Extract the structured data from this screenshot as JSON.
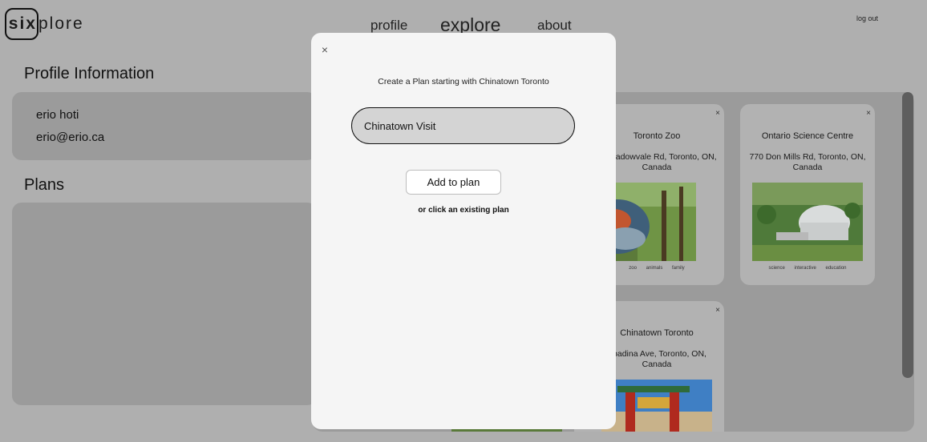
{
  "header": {
    "logo_bold": "six",
    "logo_rest": "plore",
    "nav": {
      "profile": "profile",
      "explore": "explore",
      "about": "about"
    },
    "logout": "log out"
  },
  "profile": {
    "title": "Profile Information",
    "name": "erio hoti",
    "email": "erio@erio.ca"
  },
  "plans": {
    "title": "Plans"
  },
  "explore_cards": [
    {
      "name": "Toronto Zoo",
      "address": "0 Meadowvale Rd, Toronto, ON, Canada",
      "tags": [
        "zoo",
        "animals",
        "family"
      ],
      "close": "×"
    },
    {
      "name": "Ontario Science Centre",
      "address": "770 Don Mills Rd, Toronto, ON, Canada",
      "tags": [
        "science",
        "interactive",
        "education"
      ],
      "close": "×"
    },
    {
      "name": "Chinatown Toronto",
      "address": "Spadina Ave, Toronto, ON, Canada",
      "close": "×"
    }
  ],
  "modal": {
    "close": "×",
    "title": "Create a Plan starting with Chinatown Toronto",
    "input_value": "Chinatown Visit",
    "add_button": "Add to plan",
    "or_text": "or click an existing plan"
  }
}
